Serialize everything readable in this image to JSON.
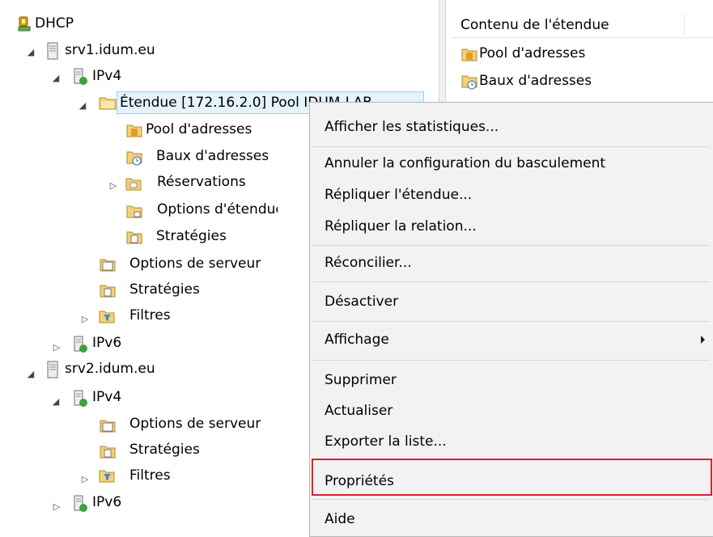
{
  "tree": {
    "root": "DHCP",
    "srv1": "srv1.idum.eu",
    "srv1_ipv4": "IPv4",
    "scope": "Étendue [172.16.2.0] Pool IDUM-LAB",
    "scope_pool": "Pool d'adresses",
    "scope_leases": "Baux d'adresses",
    "scope_reservations": "Réservations",
    "scope_options": "Options d'étendue",
    "scope_policies": "Stratégies",
    "srv1_server_options": "Options de serveur",
    "srv1_policies": "Stratégies",
    "srv1_filters": "Filtres",
    "srv1_ipv6": "IPv6",
    "srv2": "srv2.idum.eu",
    "srv2_ipv4": "IPv4",
    "srv2_server_options": "Options de serveur",
    "srv2_policies": "Stratégies",
    "srv2_filters": "Filtres",
    "srv2_ipv6": "IPv6"
  },
  "content": {
    "header": "Contenu de l'étendue",
    "items": [
      "Pool d'adresses",
      "Baux d'adresses"
    ]
  },
  "context_menu": {
    "items": [
      "Afficher les statistiques...",
      "Annuler la configuration du basculement",
      "Répliquer l'étendue...",
      "Répliquer la relation...",
      "Réconcilier...",
      "Désactiver",
      "Affichage",
      "Supprimer",
      "Actualiser",
      "Exporter la liste...",
      "Propriétés",
      "Aide"
    ]
  },
  "colors": {
    "highlight": "#e0202e",
    "selection": "#e5f3fb"
  }
}
